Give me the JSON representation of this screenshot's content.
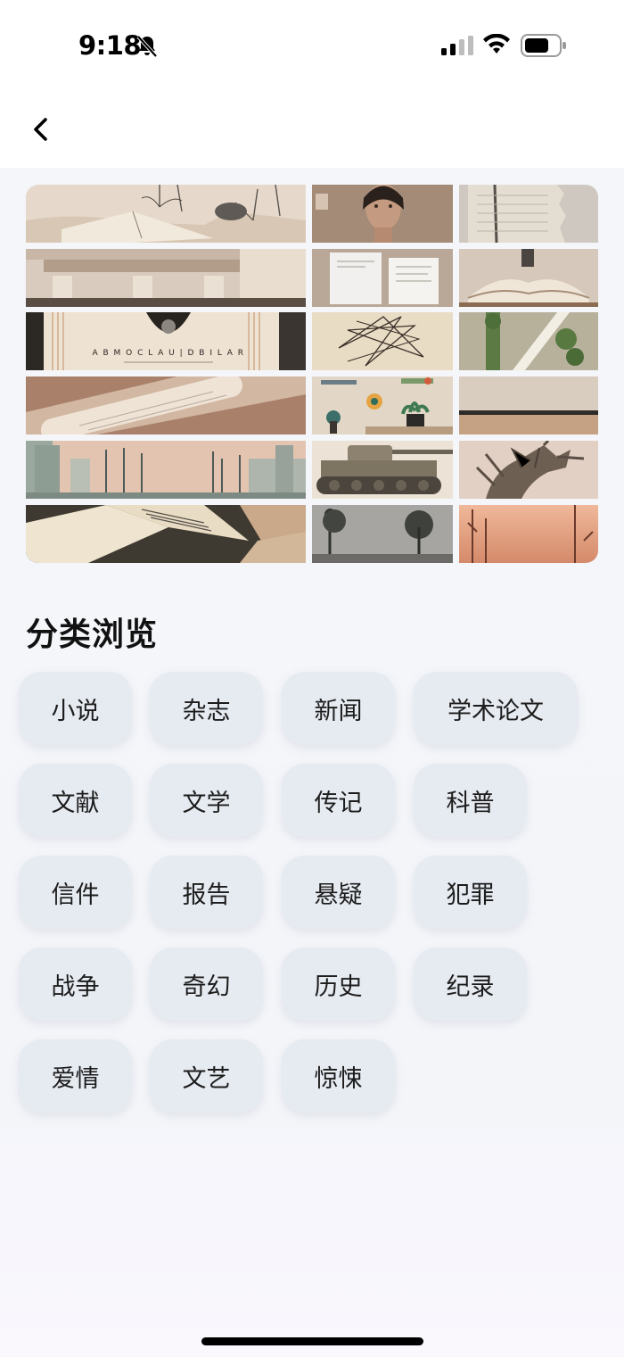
{
  "status_bar": {
    "time": "9:18"
  },
  "section": {
    "title": "分类浏览"
  },
  "categories": [
    "小说",
    "杂志",
    "新闻",
    "学术论文",
    "文献",
    "文学",
    "传记",
    "科普",
    "信件",
    "报告",
    "悬疑",
    "犯罪",
    "战争",
    "奇幻",
    "历史",
    "纪录",
    "爱情",
    "文艺",
    "惊悚"
  ],
  "mosaic": {
    "tiles": [
      "book-sketch-photo",
      "woman-portrait-photo",
      "torn-paper-photo",
      "building-photo",
      "documents-photo",
      "open-book-photo",
      "typography-poster-photo",
      "line-art-photo",
      "plant-arch-photo",
      "paper-roll-photo",
      "plant-illustration-photo",
      "horizon-photo",
      "street-lamps-photo",
      "tank-photo",
      "dragon-sculpture-photo",
      "open-books-photo",
      "forest-photo",
      "sunset-trees-photo"
    ],
    "poster_text": "A B M O C L A U | D B I L A R"
  },
  "colors": {
    "chip_bg": "#e6eaf1",
    "page_bg": "#f4f6fa"
  }
}
